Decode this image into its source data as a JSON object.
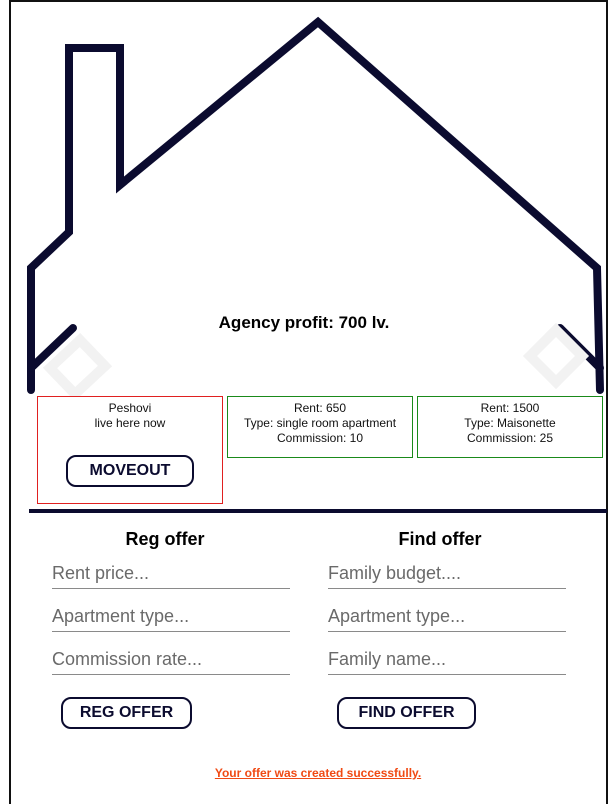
{
  "header": {
    "profit_text": "Agency profit: 700 lv."
  },
  "cards": {
    "occupied": {
      "family": "Peshovi",
      "status": "live here now",
      "moveout_label": "MOVEOUT"
    },
    "offers": [
      {
        "rent": "Rent: 650",
        "type": "Type: single room apartment",
        "commission": "Commission: 10"
      },
      {
        "rent": "Rent: 1500",
        "type": "Type: Maisonette",
        "commission": "Commission: 25"
      }
    ]
  },
  "reg_offer": {
    "title": "Reg offer",
    "rent_placeholder": "Rent price...",
    "type_placeholder": "Apartment type...",
    "commission_placeholder": "Commission rate...",
    "button_label": "REG OFFER"
  },
  "find_offer": {
    "title": "Find offer",
    "budget_placeholder": "Family budget....",
    "type_placeholder": "Apartment type...",
    "name_placeholder": "Family name...",
    "button_label": "FIND OFFER"
  },
  "status_message": "Your offer was created successfully.",
  "colors": {
    "navy": "#0b0b2f",
    "occupied_border": "#e02020",
    "offer_border": "#1a8a1a",
    "status_text": "#f04a14"
  }
}
